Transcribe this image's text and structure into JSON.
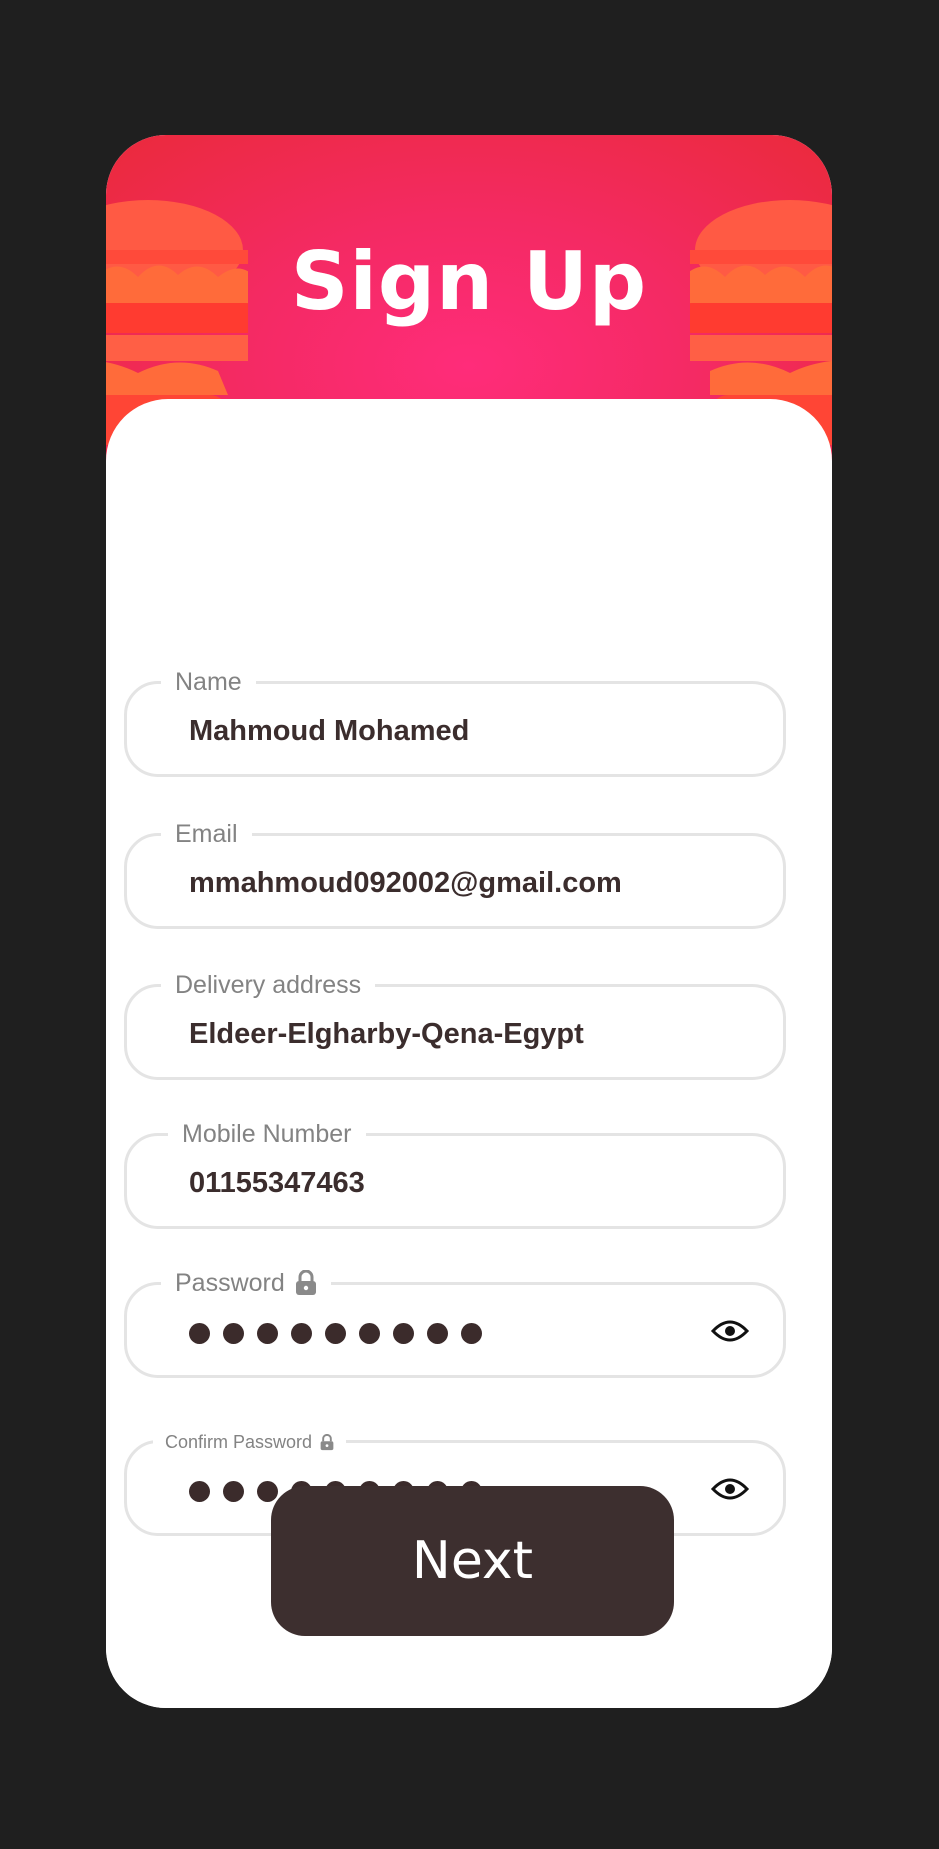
{
  "header": {
    "title": "Sign Up"
  },
  "fields": {
    "name": {
      "label": "Name",
      "value": "Mahmoud Mohamed"
    },
    "email": {
      "label": "Email",
      "value": "mmahmoud092002@gmail.com"
    },
    "address": {
      "label": "Delivery address",
      "value": "Eldeer-Elgharby-Qena-Egypt"
    },
    "mobile": {
      "label": "Mobile Number",
      "value": "01155347463"
    },
    "password": {
      "label": "Password",
      "masked_length": 9,
      "icon": "lock-icon",
      "toggle_icon": "eye-icon"
    },
    "confirm_password": {
      "label": "Confirm Password",
      "masked_length": 9,
      "icon": "lock-icon",
      "toggle_icon": "eye-icon"
    }
  },
  "actions": {
    "next_label": "Next"
  },
  "colors": {
    "background": "#1f1f1f",
    "accent": "#f42a63",
    "button": "#3d2f2f",
    "text": "#3b2d2d",
    "label": "#838383",
    "border": "#e4e4e4"
  }
}
